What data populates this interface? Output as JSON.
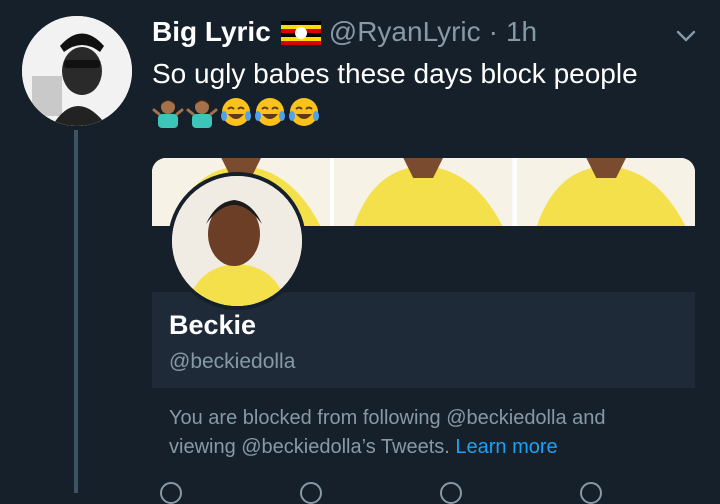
{
  "tweet": {
    "author_name": "Big Lyric",
    "flag_icon": "uganda-flag-icon",
    "handle": "@RyanLyric",
    "separator": "·",
    "time": "1h",
    "text": "So ugly babes these days block people",
    "emojis": [
      "person-shrugging-icon",
      "person-shrugging-icon",
      "tears-of-joy-icon",
      "tears-of-joy-icon",
      "tears-of-joy-icon"
    ]
  },
  "card": {
    "name": "Beckie",
    "handle": "@beckiedolla",
    "blocked_text": "You are blocked from following @beckiedolla and viewing @beckiedolla’s Tweets.",
    "learn_more": "Learn more"
  },
  "colors": {
    "background": "#15202b",
    "card_info_bg": "#1e2a37",
    "secondary_text": "#8899a6",
    "link": "#1da1f2"
  }
}
